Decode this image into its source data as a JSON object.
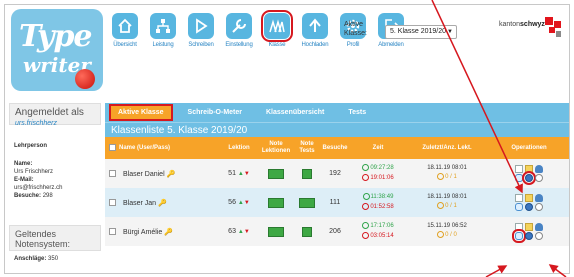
{
  "logo": {
    "line1": "Type",
    "line2": "writer"
  },
  "nav": [
    {
      "label": "Übersicht",
      "icon": "home-icon"
    },
    {
      "label": "Leistung",
      "icon": "sitemap-icon"
    },
    {
      "label": "Schreiben",
      "icon": "play-icon"
    },
    {
      "label": "Einstellung",
      "icon": "wrench-icon"
    },
    {
      "label": "Klasse",
      "icon": "class-icon"
    },
    {
      "label": "Hochladen",
      "icon": "upload-icon"
    },
    {
      "label": "Profil",
      "icon": "gear-icon"
    },
    {
      "label": "Abmelden",
      "icon": "logout-icon"
    }
  ],
  "klasse": {
    "label_line1": "Aktive",
    "label_line2": "Klasse:",
    "selected": "5. Klasse 2019/20"
  },
  "brand": {
    "prefix": "kanton",
    "name": "schwyz"
  },
  "sidebar": {
    "logged_in_title": "Angemeldet als",
    "username": "urs.frischherz",
    "role": "Lehrperson",
    "name_label": "Name:",
    "name_value": "Urs Frischherz",
    "email_label": "E-Mail:",
    "email_value": "urs@frischherz.ch",
    "visits_label": "Besuche:",
    "visits_value": "298",
    "grading_title": "Geltendes Notensystem:",
    "clicks_label": "Anschläge:",
    "clicks_value": "350"
  },
  "tabs": [
    "Aktive Klasse",
    "Schreib-O-Meter",
    "Klassenübersicht",
    "Tests"
  ],
  "list_title": "Klassenliste 5. Klasse 2019/20",
  "columns": {
    "name": "Name (User/Pass)",
    "lektion": "Lektion",
    "note_lektionen_1": "Note",
    "note_lektionen_2": "Lektionen",
    "note_tests_1": "Note",
    "note_tests_2": "Tests",
    "besuche": "Besuche",
    "zeit": "Zeit",
    "zuletzt": "Zuletzt/Anz. Lekt.",
    "operationen": "Operationen"
  },
  "rows": [
    {
      "name": "Blaser Daniel",
      "lektion": "51",
      "note_lektionen": "5.5",
      "note_tests": "6",
      "besuche": "192",
      "zeit_total": "09:27:28",
      "zeit_recent": "19:01:06",
      "zuletzt": "18.11.19 08:01",
      "anz": "0 / 1"
    },
    {
      "name": "Blaser Jan",
      "lektion": "56",
      "note_lektionen": "5.5",
      "note_tests": "5.5",
      "besuche": "111",
      "zeit_total": "11:38:49",
      "zeit_recent": "01:52:58",
      "zuletzt": "18.11.19 08:01",
      "anz": "0 / 1"
    },
    {
      "name": "Bürgi Amélie",
      "lektion": "63",
      "note_lektionen": "5.5",
      "note_tests": "6",
      "besuche": "206",
      "zeit_total": "17:17:06",
      "zeit_recent": "03:05:14",
      "zuletzt": "15.11.19 06:52",
      "anz": "0 / 0"
    }
  ],
  "colors": {
    "header_blue": "#6fbfe4",
    "table_orange": "#f7a328",
    "annotation_red": "#d6181f",
    "grade_green": "#3ea844"
  }
}
